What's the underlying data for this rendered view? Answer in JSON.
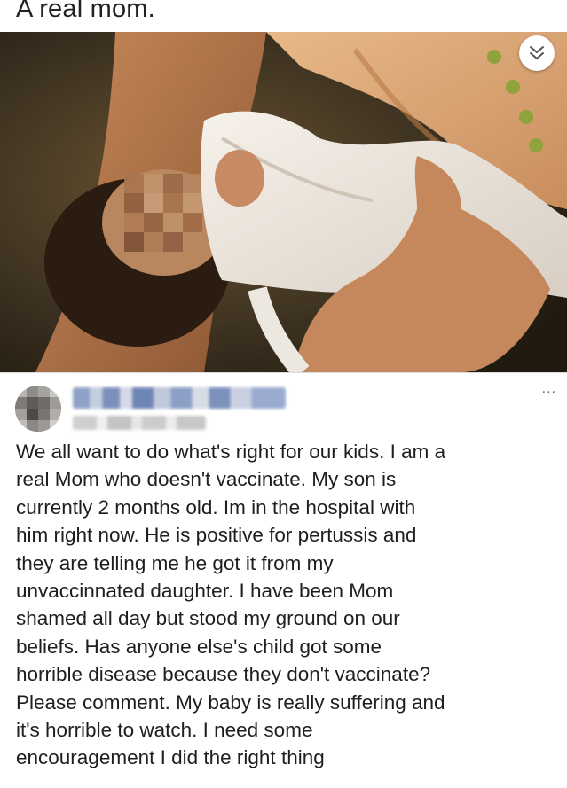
{
  "header": {
    "title": "A real mom."
  },
  "photo": {
    "description_icon": "photo"
  },
  "controls": {
    "collapse_icon": "double-chevron-down-icon"
  },
  "post": {
    "more_label": "...",
    "text": "We all want to do what's right for our kids. I am a\nreal Mom who doesn't vaccinate. My son is\ncurrently 2 months old. Im in the hospital with\nhim right now. He is positive for pertussis and\nthey are telling me he got it from my\nunvaccinnated daughter. I have been Mom\nshamed all day but stood my ground on our\nbeliefs. Has anyone else's child got some\nhorrible disease because they don't vaccinate?\nPlease comment. My baby is really suffering and\nit's horrible to watch. I need some\nencouragement I did the right thing"
  }
}
